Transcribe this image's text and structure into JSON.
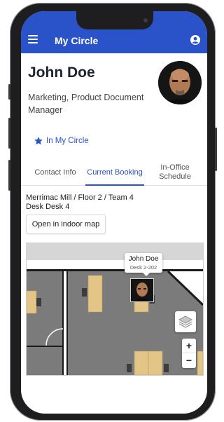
{
  "app": {
    "title": "My Circle"
  },
  "profile": {
    "name": "John Doe",
    "role": "Marketing, Product Document Manager",
    "circle_link": "In My Circle"
  },
  "tabs": [
    {
      "label": "Contact Info",
      "active": false
    },
    {
      "label": "Current Booking",
      "active": true
    },
    {
      "label": "In-Office Schedule",
      "active": false
    }
  ],
  "booking": {
    "location": "Merrimac Mill / Floor 2 / Team 4",
    "desk": "Desk Desk 4",
    "indoor_map_button": "Open in indoor map"
  },
  "map": {
    "tooltip_name": "John Doe",
    "tooltip_desk": "Desk 2-202",
    "zoom_in": "+",
    "zoom_out": "−"
  },
  "colors": {
    "accent": "#2a52c9",
    "floor": "#7b7b7b",
    "desk": "#e3c588"
  },
  "icons": [
    "menu-icon",
    "account-icon",
    "star-icon",
    "layers-icon"
  ]
}
